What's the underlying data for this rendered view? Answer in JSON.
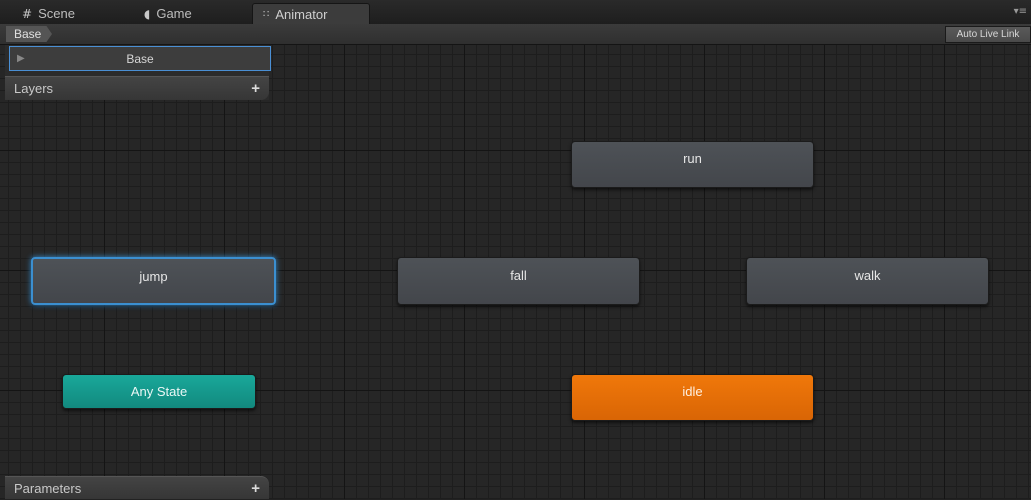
{
  "tabs": [
    {
      "label": "Scene",
      "icon": "grid-icon",
      "active": false
    },
    {
      "label": "Game",
      "icon": "pacman-icon",
      "active": false
    },
    {
      "label": "Animator",
      "icon": "animator-icon",
      "active": true
    }
  ],
  "breadcrumb": {
    "label": "Base"
  },
  "toolbar": {
    "auto_live_link_label": "Auto Live Link"
  },
  "layers": {
    "items": [
      {
        "label": "Base"
      }
    ],
    "header_label": "Layers",
    "add_label": "+"
  },
  "parameters": {
    "header_label": "Parameters",
    "add_label": "+"
  },
  "states": {
    "run": "run",
    "jump": "jump",
    "fall": "fall",
    "walk": "walk",
    "any_state": "Any State",
    "idle": "idle"
  },
  "colors": {
    "default_state": "#e86f08",
    "any_state": "#14998c",
    "selection": "#3b8fd0",
    "state": "#4a4d52"
  }
}
